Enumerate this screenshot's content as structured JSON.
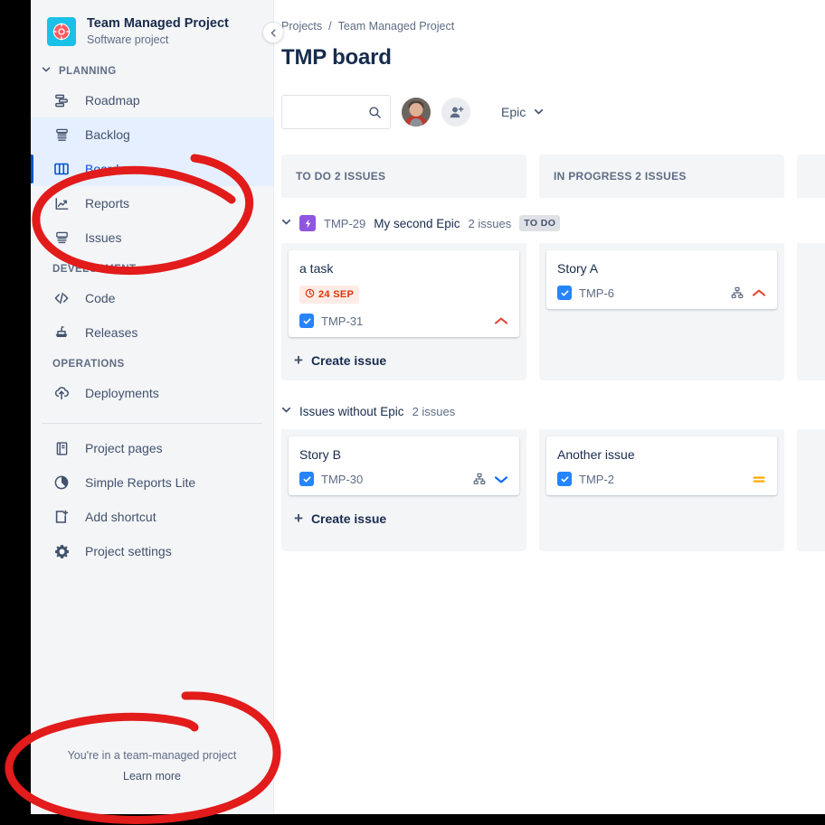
{
  "project": {
    "name": "Team Managed Project",
    "subtitle": "Software project",
    "avatar_icon": "lifebuoy-icon",
    "avatar_color": "#19c0e8"
  },
  "sidebar": {
    "collapse_icon": "chevron-left-icon",
    "sections": [
      {
        "label": "PLANNING",
        "collapsible": true,
        "items": [
          {
            "label": "Roadmap",
            "icon": "roadmap-icon",
            "state": "normal"
          },
          {
            "label": "Backlog",
            "icon": "backlog-icon",
            "state": "hover"
          },
          {
            "label": "Board",
            "icon": "board-icon",
            "state": "selected"
          },
          {
            "label": "Reports",
            "icon": "reports-icon",
            "state": "normal"
          },
          {
            "label": "Issues",
            "icon": "issues-icon",
            "state": "normal"
          }
        ]
      },
      {
        "label": "DEVELOPMENT",
        "collapsible": false,
        "items": [
          {
            "label": "Code",
            "icon": "code-icon",
            "state": "normal"
          },
          {
            "label": "Releases",
            "icon": "releases-icon",
            "state": "normal"
          }
        ]
      },
      {
        "label": "OPERATIONS",
        "collapsible": false,
        "items": [
          {
            "label": "Deployments",
            "icon": "deployments-icon",
            "state": "normal"
          }
        ]
      }
    ],
    "extra_items": [
      {
        "label": "Project pages",
        "icon": "page-icon"
      },
      {
        "label": "Simple Reports Lite",
        "icon": "pie-chart-icon"
      },
      {
        "label": "Add shortcut",
        "icon": "add-shortcut-icon"
      },
      {
        "label": "Project settings",
        "icon": "gear-icon"
      }
    ],
    "footer": {
      "text": "You're in a team-managed project",
      "link": "Learn more"
    }
  },
  "header": {
    "breadcrumb": {
      "root": "Projects",
      "separator": "/",
      "current": "Team Managed Project"
    },
    "title": "TMP board"
  },
  "toolbar": {
    "search": {
      "value": "",
      "placeholder": "",
      "icon": "search-icon"
    },
    "avatar": {
      "name": "user-avatar"
    },
    "add_person_icon": "add-person-icon",
    "epic_filter": {
      "label": "Epic",
      "chevron": "chevron-down-icon"
    }
  },
  "board": {
    "columns": [
      {
        "label": "TO DO 2 ISSUES"
      },
      {
        "label": "IN PROGRESS 2 ISSUES"
      },
      {
        "label": ""
      }
    ],
    "swimlanes": [
      {
        "type": "epic",
        "chevron": "chevron-down-icon",
        "epic_icon": "epic-bolt-icon",
        "key": "TMP-29",
        "name": "My second Epic",
        "count": "2 issues",
        "status": "TO DO",
        "lanes": [
          {
            "cards": [
              {
                "title": "a task",
                "due_badge": {
                  "icon": "clock-icon",
                  "label": "24 SEP"
                },
                "type_icon": "task-checkbox-icon",
                "key": "TMP-31",
                "subtask_icon": "",
                "priority_icon": "priority-high-icon",
                "priority_color": "#e34935"
              }
            ],
            "create_issue": {
              "label": "Create issue",
              "icon": "plus-icon"
            }
          },
          {
            "cards": [
              {
                "title": "Story A",
                "due_badge": null,
                "type_icon": "task-checkbox-icon",
                "key": "TMP-6",
                "subtask_icon": "subtask-hierarchy-icon",
                "priority_icon": "priority-high-icon",
                "priority_color": "#e34935"
              }
            ],
            "create_issue": null
          },
          {
            "cards": [],
            "create_issue": null
          }
        ]
      },
      {
        "type": "no-epic",
        "chevron": "chevron-down-icon",
        "title": "Issues without Epic",
        "count": "2 issues",
        "lanes": [
          {
            "cards": [
              {
                "title": "Story B",
                "due_badge": null,
                "type_icon": "task-checkbox-icon",
                "key": "TMP-30",
                "subtask_icon": "subtask-hierarchy-icon",
                "priority_icon": "priority-low-icon",
                "priority_color": "#0065ff"
              }
            ],
            "create_issue": {
              "label": "Create issue",
              "icon": "plus-icon"
            }
          },
          {
            "cards": [
              {
                "title": "Another issue",
                "due_badge": null,
                "type_icon": "task-checkbox-icon",
                "key": "TMP-2",
                "subtask_icon": "",
                "priority_icon": "priority-medium-icon",
                "priority_color": "#ffab00"
              }
            ],
            "create_issue": null
          },
          {
            "cards": [],
            "create_issue": null
          }
        ]
      }
    ]
  },
  "annotations": {
    "color": "#e21b1b",
    "marks": [
      {
        "name": "circle-around-board-nav"
      },
      {
        "name": "circle-around-team-managed-footer"
      }
    ]
  }
}
